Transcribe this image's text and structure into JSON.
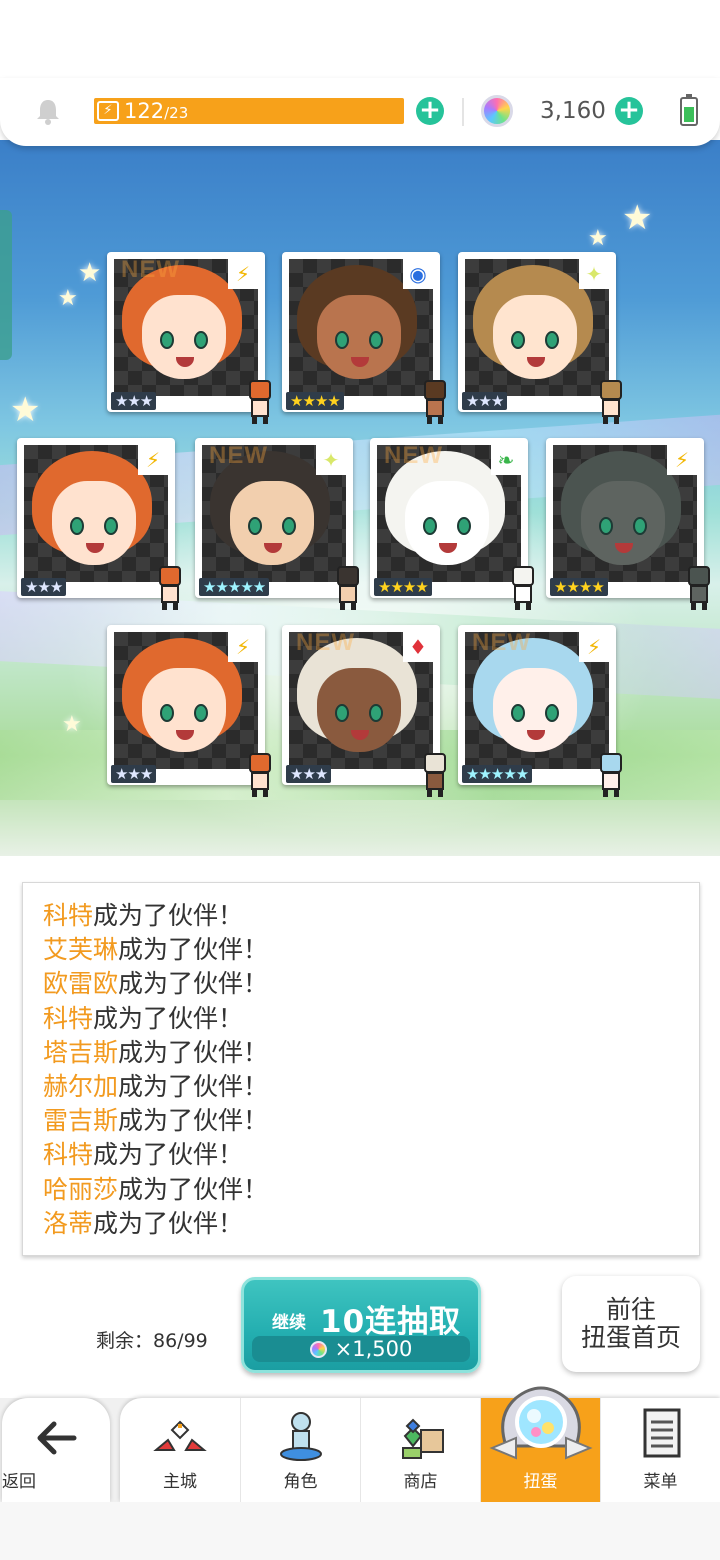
{
  "topbar": {
    "bell_icon": "bell-icon",
    "stamina_current": "122",
    "stamina_max": "23",
    "stamina_fill_fraction": 1.0,
    "gem_count": "3,160",
    "battery_icon": "battery-icon"
  },
  "cards": [
    {
      "name": "科特",
      "element": "lightning",
      "rarity": 3,
      "new": true,
      "hair": "#e0692e",
      "skin": "#ffe2cf",
      "elem_color": "#f2b705",
      "elem_glyph": "⚡"
    },
    {
      "name": "艾芙琳",
      "element": "water",
      "rarity": 4,
      "new": false,
      "hair": "#5a3a22",
      "skin": "#b9744e",
      "elem_color": "#2a6fe0",
      "elem_glyph": "◉"
    },
    {
      "name": "欧雷欧",
      "element": "light",
      "rarity": 3,
      "new": false,
      "hair": "#b58a4f",
      "skin": "#ffe4cf",
      "elem_color": "#d9e86a",
      "elem_glyph": "✦"
    },
    {
      "name": "科特",
      "element": "lightning",
      "rarity": 3,
      "new": false,
      "hair": "#e0692e",
      "skin": "#ffe2cf",
      "elem_color": "#f2b705",
      "elem_glyph": "⚡"
    },
    {
      "name": "塔吉斯",
      "element": "light",
      "rarity": 5,
      "new": true,
      "hair": "#3a3430",
      "skin": "#f2cfae",
      "elem_color": "#d9e86a",
      "elem_glyph": "✦"
    },
    {
      "name": "赫尔加",
      "element": "wind",
      "rarity": 4,
      "new": true,
      "hair": "#f4f4f0",
      "skin": "#ffffff",
      "elem_color": "#39b54a",
      "elem_glyph": "❧"
    },
    {
      "name": "雷吉斯",
      "element": "lightning",
      "rarity": 4,
      "new": false,
      "hair": "#4b5450",
      "skin": "#5e6460",
      "elem_color": "#f2b705",
      "elem_glyph": "⚡"
    },
    {
      "name": "科特",
      "element": "lightning",
      "rarity": 3,
      "new": false,
      "hair": "#e0692e",
      "skin": "#ffe2cf",
      "elem_color": "#f2b705",
      "elem_glyph": "⚡"
    },
    {
      "name": "哈丽莎",
      "element": "fire",
      "rarity": 3,
      "new": true,
      "hair": "#e9e3d6",
      "skin": "#8a5a3e",
      "elem_color": "#e0323a",
      "elem_glyph": "♦"
    },
    {
      "name": "洛蒂",
      "element": "lightning",
      "rarity": 5,
      "new": true,
      "hair": "#a8d8ee",
      "skin": "#fff0ea",
      "elem_color": "#f2b705",
      "elem_glyph": "⚡"
    }
  ],
  "new_label": "NEW",
  "log": {
    "suffix": "成为了伙伴！",
    "lines": [
      {
        "name": "科特"
      },
      {
        "name": "艾芙琳"
      },
      {
        "name": "欧雷欧"
      },
      {
        "name": "科特"
      },
      {
        "name": "塔吉斯"
      },
      {
        "name": "赫尔加"
      },
      {
        "name": "雷吉斯"
      },
      {
        "name": "科特"
      },
      {
        "name": "哈丽莎"
      },
      {
        "name": "洛蒂"
      }
    ]
  },
  "controls": {
    "remaining_label": "剩余：86/99",
    "continue_label": "继续",
    "pull_label": "10连抽取",
    "pull_cost": "×1,500",
    "home_label_line1": "前往",
    "home_label_line2": "扭蛋首页"
  },
  "nav": {
    "back_label": "返回",
    "items": [
      {
        "label": "主城",
        "icon": "castle-icon"
      },
      {
        "label": "角色",
        "icon": "character-icon"
      },
      {
        "label": "商店",
        "icon": "shop-icon"
      },
      {
        "label": "扭蛋",
        "icon": "gacha-icon",
        "active": true
      },
      {
        "label": "菜单",
        "icon": "menu-icon"
      }
    ]
  },
  "colors": {
    "accent_orange": "#f7a11a",
    "accent_teal": "#26c39a",
    "name_highlight": "#f29a1f"
  }
}
